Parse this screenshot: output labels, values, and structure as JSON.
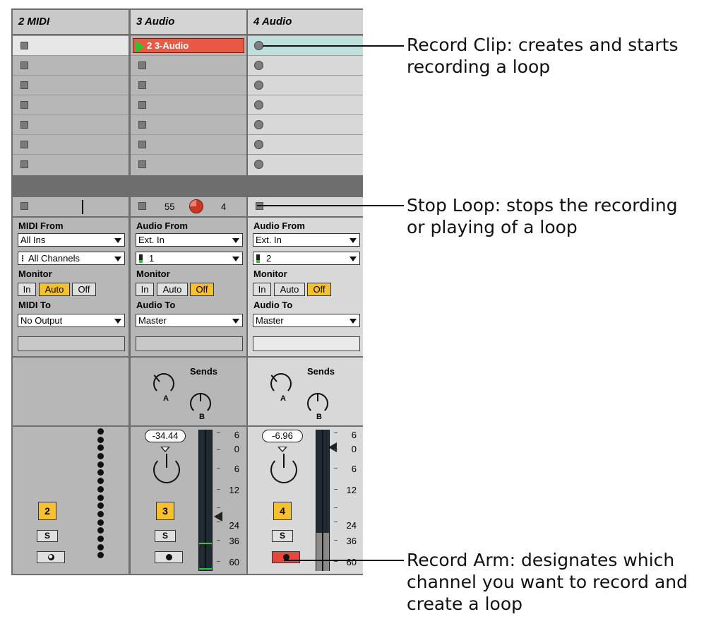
{
  "tracks": [
    {
      "name": "2 MIDI",
      "io": {
        "from_label": "MIDI From",
        "from": "All Ins",
        "channel": "All Channels",
        "monitor_label": "Monitor",
        "monitor": [
          "In",
          "Auto",
          "Off"
        ],
        "to_label": "MIDI To",
        "to": "No Output"
      },
      "number": "2",
      "solo": "S"
    },
    {
      "name": "3 Audio",
      "clip": "2 3-Audio",
      "stop_left": "55",
      "stop_right": "4",
      "io": {
        "from_label": "Audio From",
        "from": "Ext. In",
        "channel": "1",
        "monitor_label": "Monitor",
        "monitor": [
          "In",
          "Auto",
          "Off"
        ],
        "to_label": "Audio To",
        "to": "Master"
      },
      "sends_label": "Sends",
      "knob_a": "A",
      "knob_b": "B",
      "volume": "-34.44",
      "number": "3",
      "solo": "S"
    },
    {
      "name": "4 Audio",
      "io": {
        "from_label": "Audio From",
        "from": "Ext. In",
        "channel": "2",
        "monitor_label": "Monitor",
        "monitor": [
          "In",
          "Auto",
          "Off"
        ],
        "to_label": "Audio To",
        "to": "Master"
      },
      "sends_label": "Sends",
      "knob_a": "A",
      "knob_b": "B",
      "volume": "-6.96",
      "number": "4",
      "solo": "S"
    }
  ],
  "meter_scale": [
    "6",
    "0",
    "6",
    "12",
    "24",
    "36",
    "60"
  ],
  "annotations": {
    "record_clip": [
      "Record Clip: creates and starts",
      "recording a loop"
    ],
    "stop_loop": [
      "Stop Loop: stops the recording",
      "or playing of a loop"
    ],
    "record_arm": [
      "Record Arm: designates which",
      "channel you want to record and",
      "create a loop"
    ]
  },
  "colors": {
    "clip_red": "#e85a45",
    "play_green": "#2ec42e",
    "monitor_active": "#f5c12e",
    "arm_red": "#e8453c"
  }
}
